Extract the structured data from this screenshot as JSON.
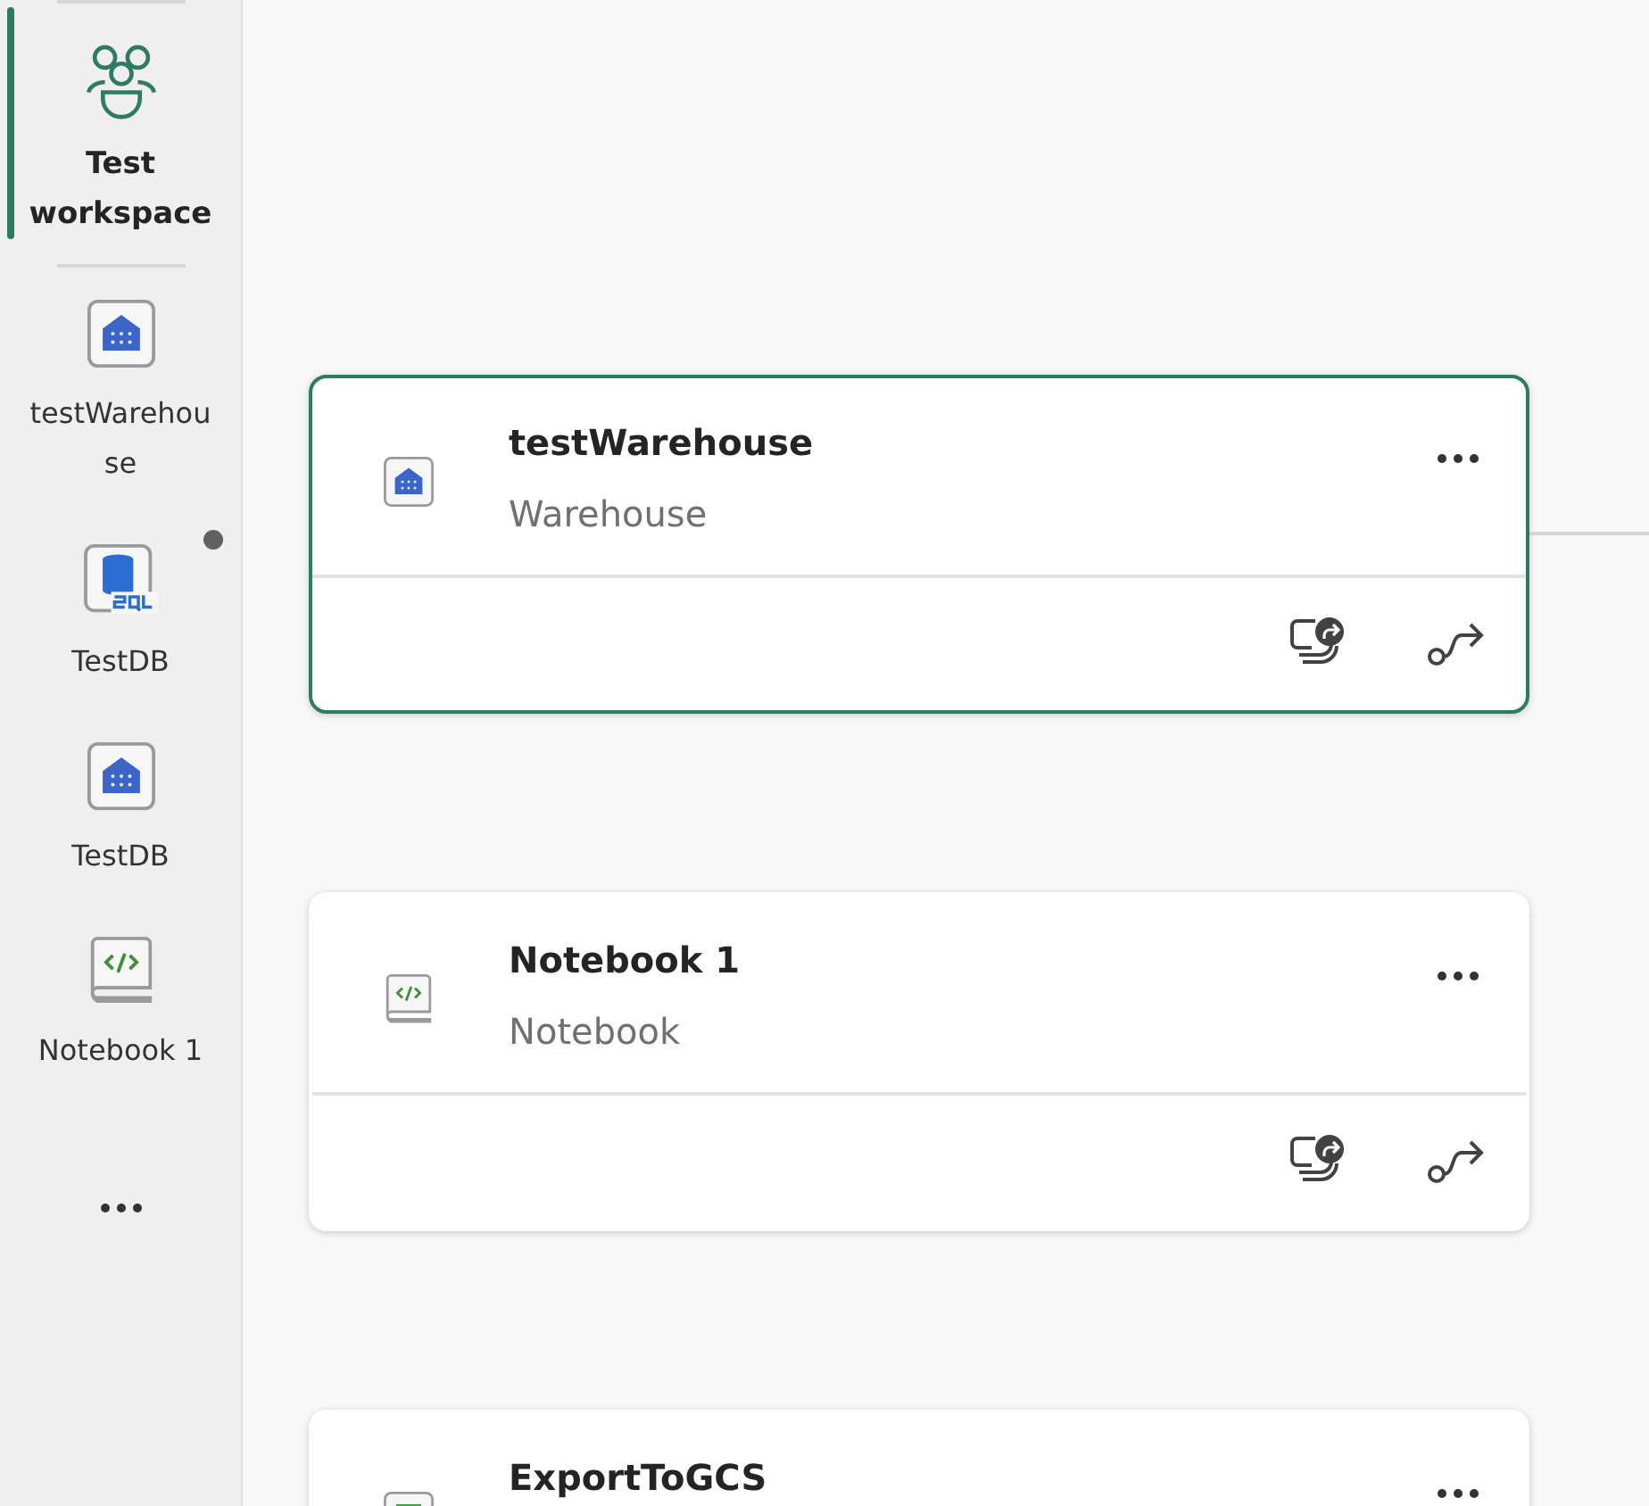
{
  "sidebar": {
    "items": [
      {
        "kind": "workspace",
        "label": "Test workspace",
        "selected": true,
        "indicator": false
      },
      {
        "kind": "warehouse",
        "label": "testWarehouse",
        "selected": false,
        "indicator": false
      },
      {
        "kind": "sql_database",
        "label": "TestDB",
        "selected": false,
        "indicator": true
      },
      {
        "kind": "warehouse",
        "label": "TestDB",
        "selected": false,
        "indicator": false
      },
      {
        "kind": "notebook",
        "label": "Notebook 1",
        "selected": false,
        "indicator": false
      }
    ]
  },
  "cards": [
    {
      "kind": "warehouse",
      "title": "testWarehouse",
      "type": "Warehouse",
      "selected": true,
      "connected": true,
      "actions": [
        {
          "kind": "share"
        },
        {
          "kind": "lineage"
        }
      ]
    },
    {
      "kind": "notebook",
      "title": "Notebook 1",
      "type": "Notebook",
      "selected": false,
      "connected": false,
      "actions": [
        {
          "kind": "share"
        },
        {
          "kind": "lineage"
        }
      ]
    },
    {
      "kind": "pipeline",
      "title": "ExportToGCS",
      "selected": false,
      "connected": false
    }
  ]
}
